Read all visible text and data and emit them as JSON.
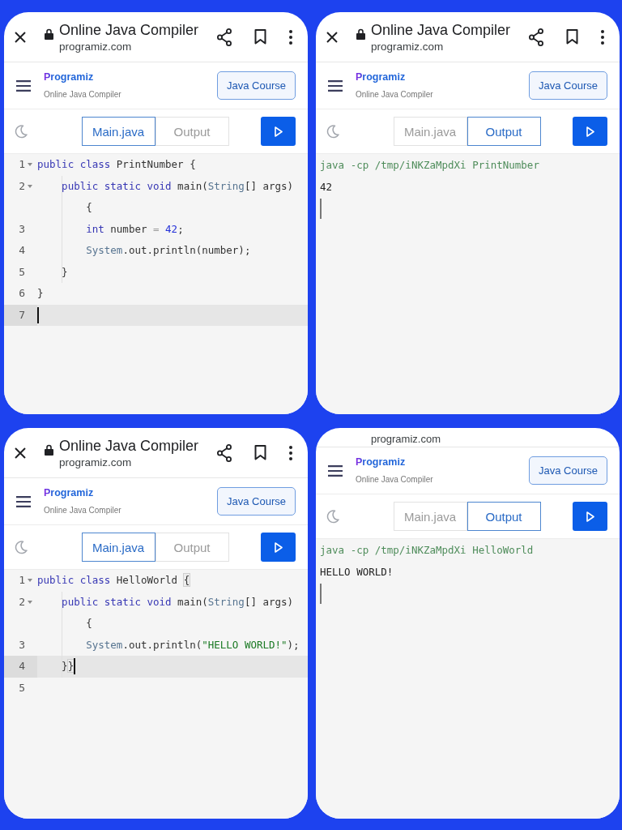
{
  "panels": [
    {
      "kind": "editor",
      "browser_bar": {
        "title": "Online Java Compiler",
        "url": "programiz.com"
      },
      "site_header": {
        "logo": "Programiz",
        "subtitle": "Online Java Compiler",
        "course_button": "Java Course"
      },
      "tabs": [
        {
          "label": "Main.java",
          "selected": true
        },
        {
          "label": "Output",
          "selected": false
        }
      ],
      "editor": {
        "lines": [
          {
            "number": "1",
            "foldable": true,
            "active": false,
            "cursor": false,
            "rows": [
              {
                "tokens": [
                  {
                    "kind": "keyword",
                    "text": "public class"
                  },
                  {
                    "kind": "plain",
                    "text": " PrintNumber {"
                  }
                ]
              }
            ]
          },
          {
            "number": "2",
            "foldable": true,
            "active": false,
            "cursor": false,
            "rows": [
              {
                "indent": "    ",
                "tokens": [
                  {
                    "kind": "keyword",
                    "text": "public static void"
                  },
                  {
                    "kind": "plain",
                    "text": " main("
                  },
                  {
                    "kind": "type",
                    "text": "String"
                  },
                  {
                    "kind": "plain",
                    "text": "[] args)"
                  }
                ]
              },
              {
                "indent": "        ",
                "tokens": [
                  {
                    "kind": "plain",
                    "text": "{"
                  }
                ]
              }
            ]
          },
          {
            "number": "3",
            "foldable": false,
            "active": false,
            "cursor": false,
            "rows": [
              {
                "indent": "        ",
                "tokens": [
                  {
                    "kind": "keyword",
                    "text": "int"
                  },
                  {
                    "kind": "plain",
                    "text": " number"
                  },
                  {
                    "kind": "operator",
                    "text": " = "
                  },
                  {
                    "kind": "number",
                    "text": "42"
                  },
                  {
                    "kind": "plain",
                    "text": ";"
                  }
                ]
              }
            ]
          },
          {
            "number": "4",
            "foldable": false,
            "active": false,
            "cursor": false,
            "rows": [
              {
                "indent": "        ",
                "tokens": [
                  {
                    "kind": "type",
                    "text": "System"
                  },
                  {
                    "kind": "plain",
                    "text": ".out.println(number);"
                  }
                ]
              }
            ]
          },
          {
            "number": "5",
            "foldable": false,
            "active": false,
            "cursor": false,
            "rows": [
              {
                "indent": "    ",
                "tokens": [
                  {
                    "kind": "plain",
                    "text": "}"
                  }
                ]
              }
            ]
          },
          {
            "number": "6",
            "foldable": false,
            "active": false,
            "cursor": false,
            "rows": [
              {
                "tokens": [
                  {
                    "kind": "plain",
                    "text": "}"
                  }
                ]
              }
            ]
          },
          {
            "number": "7",
            "foldable": false,
            "active": true,
            "cursor": true
          }
        ]
      }
    },
    {
      "kind": "output",
      "browser_bar": {
        "title": "Online Java Compiler",
        "url": "programiz.com"
      },
      "site_header": {
        "logo": "Programiz",
        "subtitle": "Online Java Compiler",
        "course_button": "Java Course"
      },
      "tabs": [
        {
          "label": "Main.java",
          "selected": false
        },
        {
          "label": "Output",
          "selected": true
        }
      ],
      "output": {
        "command": "java -cp /tmp/iNKZaMpdXi PrintNumber",
        "lines": [
          "42"
        ],
        "cursor": true
      }
    },
    {
      "kind": "editor",
      "browser_bar": {
        "title": "Online Java Compiler",
        "url": "programiz.com"
      },
      "site_header": {
        "logo": "Programiz",
        "subtitle": "Online Java Compiler",
        "course_button": "Java Course"
      },
      "tabs": [
        {
          "label": "Main.java",
          "selected": true
        },
        {
          "label": "Output",
          "selected": false
        }
      ],
      "editor": {
        "lines": [
          {
            "number": "1",
            "foldable": true,
            "active": false,
            "cursor": false,
            "rows": [
              {
                "tokens": [
                  {
                    "kind": "keyword",
                    "text": "public class"
                  },
                  {
                    "kind": "plain",
                    "text": " HelloWorld "
                  },
                  {
                    "kind": "bracket-match",
                    "text": "{"
                  }
                ]
              }
            ]
          },
          {
            "number": "2",
            "foldable": true,
            "active": false,
            "cursor": false,
            "rows": [
              {
                "indent": "    ",
                "tokens": [
                  {
                    "kind": "keyword",
                    "text": "public static void"
                  },
                  {
                    "kind": "plain",
                    "text": " main("
                  },
                  {
                    "kind": "type",
                    "text": "String"
                  },
                  {
                    "kind": "plain",
                    "text": "[] args)"
                  }
                ]
              },
              {
                "indent": "        ",
                "tokens": [
                  {
                    "kind": "plain",
                    "text": "{"
                  }
                ]
              }
            ]
          },
          {
            "number": "3",
            "foldable": false,
            "active": false,
            "cursor": false,
            "rows": [
              {
                "indent": "        ",
                "tokens": [
                  {
                    "kind": "type",
                    "text": "System"
                  },
                  {
                    "kind": "plain",
                    "text": ".out.println("
                  },
                  {
                    "kind": "string",
                    "text": "\"HELLO WORLD!\""
                  },
                  {
                    "kind": "plain",
                    "text": ");"
                  }
                ]
              }
            ]
          },
          {
            "number": "4",
            "foldable": false,
            "active": true,
            "cursor": true,
            "rows": [
              {
                "indent": "    ",
                "tokens": [
                  {
                    "kind": "plain",
                    "text": "}"
                  },
                  {
                    "kind": "bracket-match",
                    "text": "}"
                  }
                ]
              }
            ]
          },
          {
            "number": "5",
            "foldable": false,
            "active": false,
            "cursor": false
          }
        ]
      }
    },
    {
      "kind": "output",
      "address_strip": {
        "url": "programiz.com"
      },
      "site_header": {
        "logo": "Programiz",
        "subtitle": "Online Java Compiler",
        "course_button": "Java Course"
      },
      "tabs": [
        {
          "label": "Main.java",
          "selected": false
        },
        {
          "label": "Output",
          "selected": true
        }
      ],
      "output": {
        "command": "java -cp /tmp/iNKZaMpdXi HelloWorld",
        "lines": [
          "HELLO WORLD!"
        ],
        "cursor": true
      }
    }
  ]
}
